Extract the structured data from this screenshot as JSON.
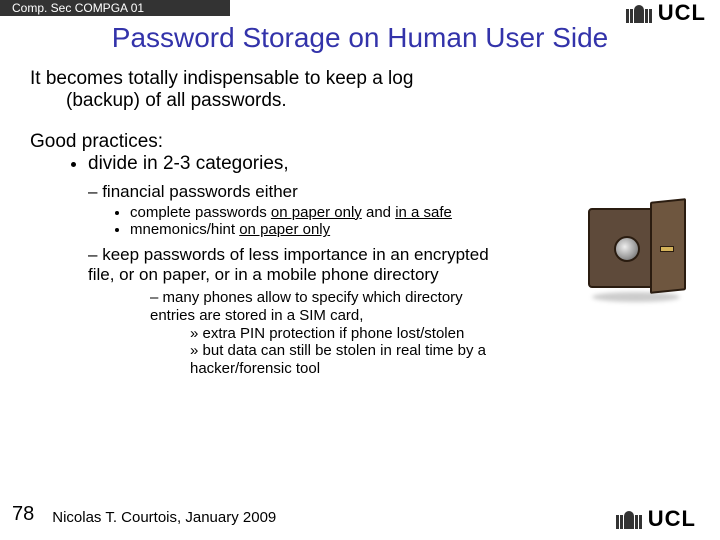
{
  "header": {
    "course": "Comp. Sec COMPGA 01"
  },
  "logo": {
    "text": "UCL"
  },
  "title": "Password Storage on Human User Side",
  "intro": {
    "line1": "It becomes totally indispensable to keep a log",
    "line2": "(backup) of all passwords."
  },
  "practices": {
    "heading": "Good practices:",
    "bullet1": "divide in 2-3 categories,",
    "fin_label": "financial passwords either",
    "fin_sub1_pre": "complete passwords ",
    "fin_sub1_u": "on paper only",
    "fin_sub1_mid": " and ",
    "fin_sub1_u2": "in a safe",
    "fin_sub2_pre": "mnemonics/hint ",
    "fin_sub2_u": "on paper only",
    "lesser": "keep passwords of less importance in an encrypted file, or on paper, or in a mobile phone directory",
    "phones": "many phones allow to specify which directory entries are stored in a SIM card,",
    "r1": "extra PIN protection if phone lost/stolen",
    "r2": "but data can still be stolen in real time by a hacker/forensic tool"
  },
  "footer": {
    "page": "78",
    "author": "Nicolas T. Courtois, January 2009"
  }
}
